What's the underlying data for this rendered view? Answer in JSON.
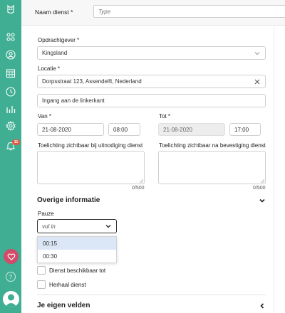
{
  "header": {
    "naam_dienst_label": "Naam dienst *",
    "naam_dienst_placeholder": "Type"
  },
  "form": {
    "opdrachtgever": {
      "label": "Opdrachtgever *",
      "value": "Kingsland"
    },
    "locatie": {
      "label": "Locatie *",
      "value": "Dorpsstraat 123, Assendelft, Nederland",
      "extra": "Ingang aan de linkerkant"
    },
    "van": {
      "label": "Van *",
      "date": "21-08-2020",
      "time": "08:00"
    },
    "tot": {
      "label": "Tot *",
      "date": "21-08-2020",
      "time": "17:00"
    },
    "toelichting_uitnodiging": {
      "label": "Toelichting zichtbaar bij uitnodiging dienst",
      "counter": "0/500"
    },
    "toelichting_bevestiging": {
      "label": "Toelichting zichtbaar na bevestiging dienst",
      "counter": "0/500"
    }
  },
  "overige": {
    "title": "Overige informatie",
    "pauze_label": "Pauze",
    "pauze_placeholder": "vul in",
    "pauze_options": [
      "00:15",
      "00:30"
    ],
    "highlighted_option": "00:15",
    "beschikbaar_label": "Dienst beschikbaar tot",
    "herhaal_label": "Herhaal dienst"
  },
  "eigen_velden": {
    "title": "Je eigen velden"
  },
  "sidebar": {
    "icons": [
      "owl-logo-icon",
      "dashboard-icon",
      "user-icon",
      "calendar-icon",
      "clock-icon",
      "bar-chart-icon",
      "gear-icon",
      "bell-icon"
    ],
    "notification_count": "11"
  },
  "colors": {
    "sidebar": "#3fae92",
    "heart": "#d44a6a",
    "badge": "#e4573c",
    "highlight": "#dbe6f6"
  }
}
